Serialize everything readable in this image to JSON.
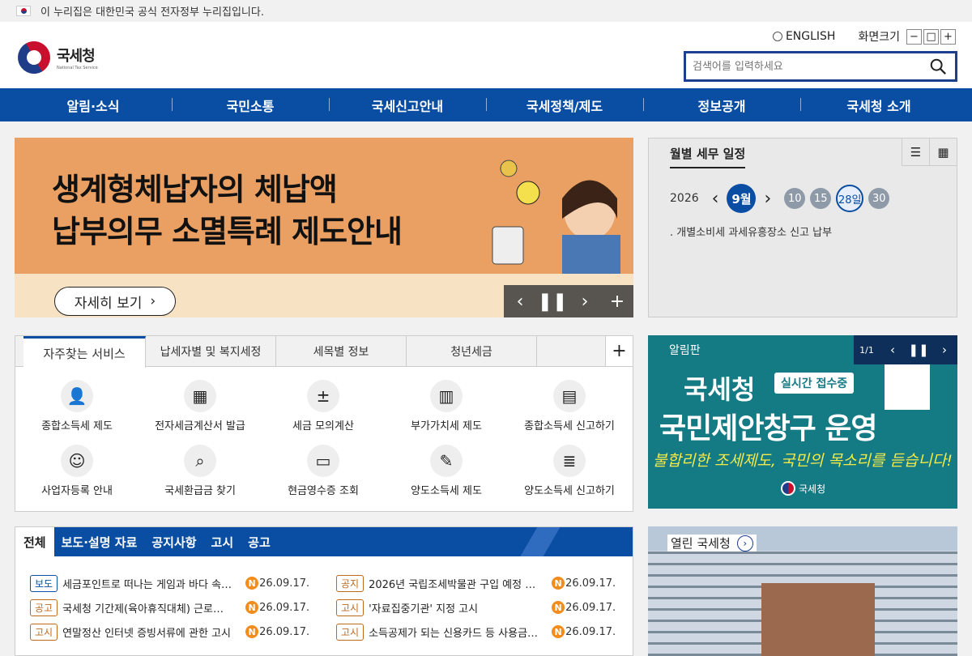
{
  "gov_banner": {
    "text": "이 누리집은 대한민국 공식 전자정부 누리집입니다."
  },
  "logo": {
    "name_ko": "국세청",
    "name_en": "National Tax Service"
  },
  "util": {
    "english": "ENGLISH",
    "zoom_label": "화면크기",
    "zoom_out": "−",
    "zoom_reset": "□",
    "zoom_in": "+"
  },
  "search": {
    "placeholder": "검색어를 입력하세요"
  },
  "gnb": [
    "알림·소식",
    "국민소통",
    "국세신고안내",
    "국세정책/제도",
    "정보공개",
    "국세청 소개"
  ],
  "banner": {
    "line1": "생계형체납자의 체납액",
    "line2": "납부의무 소멸특례 제도안내",
    "button": "자세히 보기"
  },
  "schedule": {
    "title": "월별 세무 일정",
    "year": "2026",
    "month": "9월",
    "days": [
      "10",
      "15",
      "28일",
      "30"
    ],
    "selected_day": "28일",
    "event": ". 개별소비세 과세유흥장소 신고 납부"
  },
  "services": {
    "tabs": [
      "자주찾는 서비스",
      "납세자별 및 복지세정",
      "세목별 정보",
      "청년세금"
    ],
    "items": [
      {
        "label": "종합소득세 제도",
        "icon": "person-icon"
      },
      {
        "label": "전자세금계산서 발급",
        "icon": "calculator-icon"
      },
      {
        "label": "세금 모의계산",
        "icon": "math-icon"
      },
      {
        "label": "부가가치세 제도",
        "icon": "book-icon"
      },
      {
        "label": "종합소득세 신고하기",
        "icon": "document-icon"
      },
      {
        "label": "사업자등록 안내",
        "icon": "id-card-icon"
      },
      {
        "label": "국세환급금 찾기",
        "icon": "magnifier-icon"
      },
      {
        "label": "현금영수증 조회",
        "icon": "receipt-icon"
      },
      {
        "label": "양도소득세 제도",
        "icon": "edit-icon"
      },
      {
        "label": "양도소득세 신고하기",
        "icon": "list-icon"
      }
    ]
  },
  "notice": {
    "label": "알림판",
    "page": "1/1",
    "head": "국세청",
    "chip": "실시간 접수중",
    "big": "국민제안창구 운영",
    "sub": "불합리한 조세제도, 국민의 목소리를 듣습니다!",
    "logo": "국세청"
  },
  "news": {
    "tabs": [
      "전체",
      "보도·설명 자료",
      "공지사항",
      "고시",
      "공고"
    ],
    "rows": [
      {
        "badge": "보도",
        "title": "세금포인트로 떠나는 게임과 바다 속…",
        "date": "26.09.17."
      },
      {
        "badge": "공지",
        "title": "2026년 국립조세박물관 구입 예정 …",
        "date": "26.09.17."
      },
      {
        "badge": "공고",
        "title": "국세청 기간제(육아휴직대체) 근로…",
        "date": "26.09.17."
      },
      {
        "badge": "고시",
        "title": "'자료집중기관' 지정 고시",
        "date": "26.09.17."
      },
      {
        "badge": "고시",
        "title": "연말정산 인터넷 증빙서류에 관한 고시",
        "date": "26.09.17."
      },
      {
        "badge": "고시",
        "title": "소득공제가 되는 신용카드 등 사용금…",
        "date": "26.09.17."
      }
    ],
    "new_mark": "N"
  },
  "open": {
    "title": "열린 국세청"
  }
}
